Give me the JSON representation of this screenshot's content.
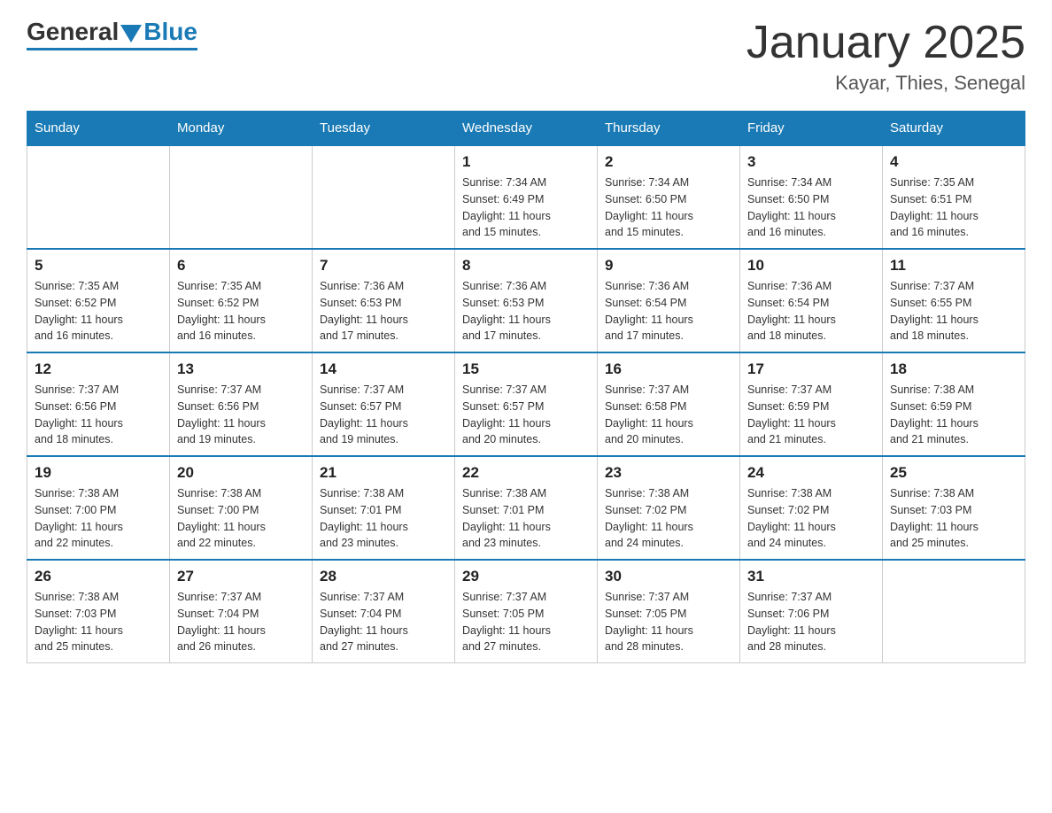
{
  "header": {
    "logo": {
      "general": "General",
      "blue": "Blue"
    },
    "title": "January 2025",
    "subtitle": "Kayar, Thies, Senegal"
  },
  "days_of_week": [
    "Sunday",
    "Monday",
    "Tuesday",
    "Wednesday",
    "Thursday",
    "Friday",
    "Saturday"
  ],
  "weeks": [
    [
      {
        "day": "",
        "info": ""
      },
      {
        "day": "",
        "info": ""
      },
      {
        "day": "",
        "info": ""
      },
      {
        "day": "1",
        "info": "Sunrise: 7:34 AM\nSunset: 6:49 PM\nDaylight: 11 hours\nand 15 minutes."
      },
      {
        "day": "2",
        "info": "Sunrise: 7:34 AM\nSunset: 6:50 PM\nDaylight: 11 hours\nand 15 minutes."
      },
      {
        "day": "3",
        "info": "Sunrise: 7:34 AM\nSunset: 6:50 PM\nDaylight: 11 hours\nand 16 minutes."
      },
      {
        "day": "4",
        "info": "Sunrise: 7:35 AM\nSunset: 6:51 PM\nDaylight: 11 hours\nand 16 minutes."
      }
    ],
    [
      {
        "day": "5",
        "info": "Sunrise: 7:35 AM\nSunset: 6:52 PM\nDaylight: 11 hours\nand 16 minutes."
      },
      {
        "day": "6",
        "info": "Sunrise: 7:35 AM\nSunset: 6:52 PM\nDaylight: 11 hours\nand 16 minutes."
      },
      {
        "day": "7",
        "info": "Sunrise: 7:36 AM\nSunset: 6:53 PM\nDaylight: 11 hours\nand 17 minutes."
      },
      {
        "day": "8",
        "info": "Sunrise: 7:36 AM\nSunset: 6:53 PM\nDaylight: 11 hours\nand 17 minutes."
      },
      {
        "day": "9",
        "info": "Sunrise: 7:36 AM\nSunset: 6:54 PM\nDaylight: 11 hours\nand 17 minutes."
      },
      {
        "day": "10",
        "info": "Sunrise: 7:36 AM\nSunset: 6:54 PM\nDaylight: 11 hours\nand 18 minutes."
      },
      {
        "day": "11",
        "info": "Sunrise: 7:37 AM\nSunset: 6:55 PM\nDaylight: 11 hours\nand 18 minutes."
      }
    ],
    [
      {
        "day": "12",
        "info": "Sunrise: 7:37 AM\nSunset: 6:56 PM\nDaylight: 11 hours\nand 18 minutes."
      },
      {
        "day": "13",
        "info": "Sunrise: 7:37 AM\nSunset: 6:56 PM\nDaylight: 11 hours\nand 19 minutes."
      },
      {
        "day": "14",
        "info": "Sunrise: 7:37 AM\nSunset: 6:57 PM\nDaylight: 11 hours\nand 19 minutes."
      },
      {
        "day": "15",
        "info": "Sunrise: 7:37 AM\nSunset: 6:57 PM\nDaylight: 11 hours\nand 20 minutes."
      },
      {
        "day": "16",
        "info": "Sunrise: 7:37 AM\nSunset: 6:58 PM\nDaylight: 11 hours\nand 20 minutes."
      },
      {
        "day": "17",
        "info": "Sunrise: 7:37 AM\nSunset: 6:59 PM\nDaylight: 11 hours\nand 21 minutes."
      },
      {
        "day": "18",
        "info": "Sunrise: 7:38 AM\nSunset: 6:59 PM\nDaylight: 11 hours\nand 21 minutes."
      }
    ],
    [
      {
        "day": "19",
        "info": "Sunrise: 7:38 AM\nSunset: 7:00 PM\nDaylight: 11 hours\nand 22 minutes."
      },
      {
        "day": "20",
        "info": "Sunrise: 7:38 AM\nSunset: 7:00 PM\nDaylight: 11 hours\nand 22 minutes."
      },
      {
        "day": "21",
        "info": "Sunrise: 7:38 AM\nSunset: 7:01 PM\nDaylight: 11 hours\nand 23 minutes."
      },
      {
        "day": "22",
        "info": "Sunrise: 7:38 AM\nSunset: 7:01 PM\nDaylight: 11 hours\nand 23 minutes."
      },
      {
        "day": "23",
        "info": "Sunrise: 7:38 AM\nSunset: 7:02 PM\nDaylight: 11 hours\nand 24 minutes."
      },
      {
        "day": "24",
        "info": "Sunrise: 7:38 AM\nSunset: 7:02 PM\nDaylight: 11 hours\nand 24 minutes."
      },
      {
        "day": "25",
        "info": "Sunrise: 7:38 AM\nSunset: 7:03 PM\nDaylight: 11 hours\nand 25 minutes."
      }
    ],
    [
      {
        "day": "26",
        "info": "Sunrise: 7:38 AM\nSunset: 7:03 PM\nDaylight: 11 hours\nand 25 minutes."
      },
      {
        "day": "27",
        "info": "Sunrise: 7:37 AM\nSunset: 7:04 PM\nDaylight: 11 hours\nand 26 minutes."
      },
      {
        "day": "28",
        "info": "Sunrise: 7:37 AM\nSunset: 7:04 PM\nDaylight: 11 hours\nand 27 minutes."
      },
      {
        "day": "29",
        "info": "Sunrise: 7:37 AM\nSunset: 7:05 PM\nDaylight: 11 hours\nand 27 minutes."
      },
      {
        "day": "30",
        "info": "Sunrise: 7:37 AM\nSunset: 7:05 PM\nDaylight: 11 hours\nand 28 minutes."
      },
      {
        "day": "31",
        "info": "Sunrise: 7:37 AM\nSunset: 7:06 PM\nDaylight: 11 hours\nand 28 minutes."
      },
      {
        "day": "",
        "info": ""
      }
    ]
  ]
}
